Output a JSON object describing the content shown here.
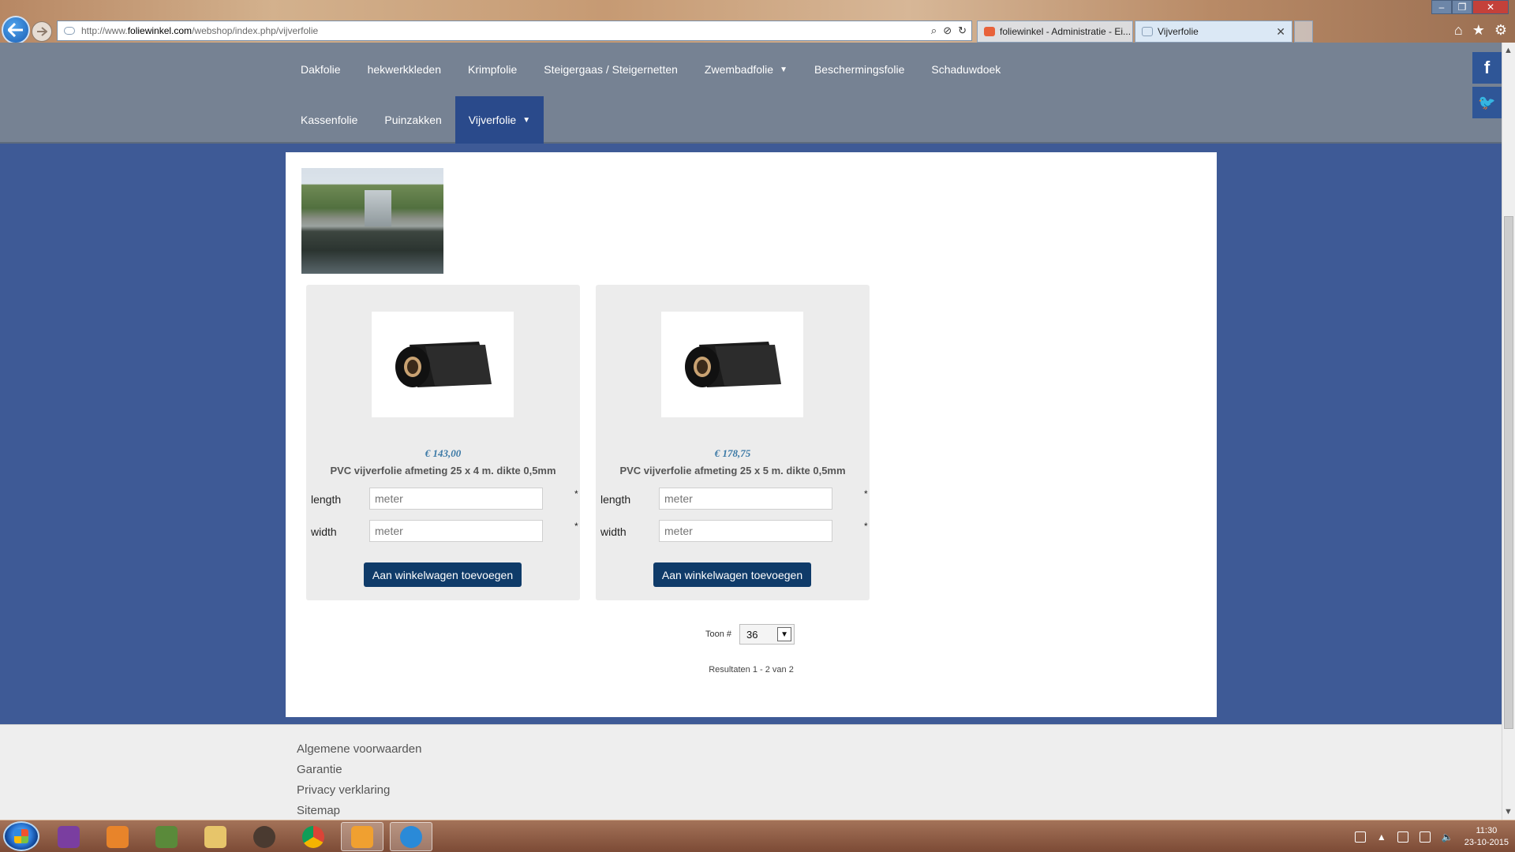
{
  "browser": {
    "url_prefix": "http://www.",
    "url_domain": "foliewinkel.com",
    "url_path": "/webshop/index.php/vijverfolie",
    "tabs": [
      {
        "label": "foliewinkel - Administratie - Ei..."
      },
      {
        "label": "Vijverfolie"
      }
    ],
    "window_controls": {
      "minimize": "–",
      "restore": "❐",
      "close": "✕"
    }
  },
  "nav": {
    "row1": [
      "Dakfolie",
      "hekwerkkleden",
      "Krimpfolie",
      "Steigergaas / Steigernetten",
      "Zwembadfolie",
      "Beschermingsfolie",
      "Schaduwdoek"
    ],
    "row2": [
      "Kassenfolie",
      "Puinzakken",
      "Vijverfolie"
    ],
    "dropdown_caret": "▼",
    "active_item": "Vijverfolie"
  },
  "social": {
    "facebook": "f",
    "twitter": "🐦"
  },
  "products": [
    {
      "price": "€ 143,00",
      "name": "PVC vijverfolie afmeting 25 x 4 m. dikte 0,5mm",
      "length_label": "length",
      "width_label": "width",
      "length_placeholder": "meter",
      "width_placeholder": "meter",
      "required_mark": "*",
      "add_to_cart": "Aan winkelwagen toevoegen"
    },
    {
      "price": "€ 178,75",
      "name": "PVC vijverfolie afmeting 25 x 5 m. dikte 0,5mm",
      "length_label": "length",
      "width_label": "width",
      "length_placeholder": "meter",
      "width_placeholder": "meter",
      "required_mark": "*",
      "add_to_cart": "Aan winkelwagen toevoegen"
    }
  ],
  "pagination": {
    "toon_label": "Toon #",
    "per_page": "36",
    "results": "Resultaten 1 - 2 van 2"
  },
  "footer": {
    "links": [
      "Algemene voorwaarden",
      "Garantie",
      "Privacy verklaring",
      "Sitemap"
    ]
  },
  "taskbar": {
    "apps": [
      "onenote-icon",
      "media-player-icon",
      "minecraft-icon",
      "file-explorer-icon",
      "app-icon",
      "chrome-icon",
      "outlook-icon",
      "internet-explorer-icon"
    ],
    "clock_time": "11:30",
    "clock_date": "23-10-2015"
  },
  "colors": {
    "page_background": "#3e5a96",
    "nav_background": "#768293",
    "nav_active": "#2a4a8b",
    "button": "#0f3b69",
    "price": "#3b79a6"
  }
}
